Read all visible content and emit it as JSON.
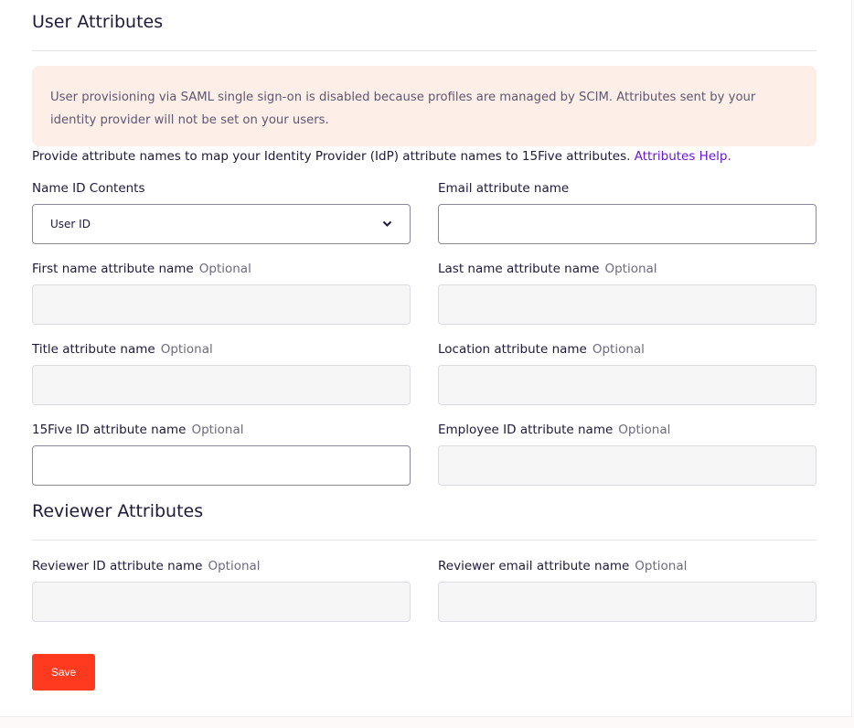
{
  "user_section": {
    "title": "User Attributes"
  },
  "notice": "User provisioning via SAML single sign-on is disabled because profiles are managed by SCIM. Attributes sent by your identity provider will not be set on your users.",
  "intro": {
    "text": "Provide attribute names to map your Identity Provider (IdP) attribute names to 15Five attributes. ",
    "link": "Attributes Help."
  },
  "fields": {
    "name_id": {
      "label": "Name ID Contents",
      "value": "User ID"
    },
    "email": {
      "label": "Email attribute name",
      "value": ""
    },
    "first_name": {
      "label": "First name attribute name",
      "optional": "Optional"
    },
    "last_name": {
      "label": "Last name attribute name",
      "optional": "Optional"
    },
    "title": {
      "label": "Title attribute name",
      "optional": "Optional"
    },
    "location": {
      "label": "Location attribute name",
      "optional": "Optional"
    },
    "fifteen_five_id": {
      "label": "15Five ID attribute name",
      "optional": "Optional"
    },
    "employee_id": {
      "label": "Employee ID attribute name",
      "optional": "Optional"
    }
  },
  "reviewer_section": {
    "title": "Reviewer Attributes",
    "reviewer_id": {
      "label": "Reviewer ID attribute name",
      "optional": "Optional"
    },
    "reviewer_email": {
      "label": "Reviewer email attribute name",
      "optional": "Optional"
    }
  },
  "save_label": "Save",
  "colors": {
    "accent": "#ff3a1f",
    "link": "#6a17d6",
    "notice_bg": "#fdeee8"
  }
}
